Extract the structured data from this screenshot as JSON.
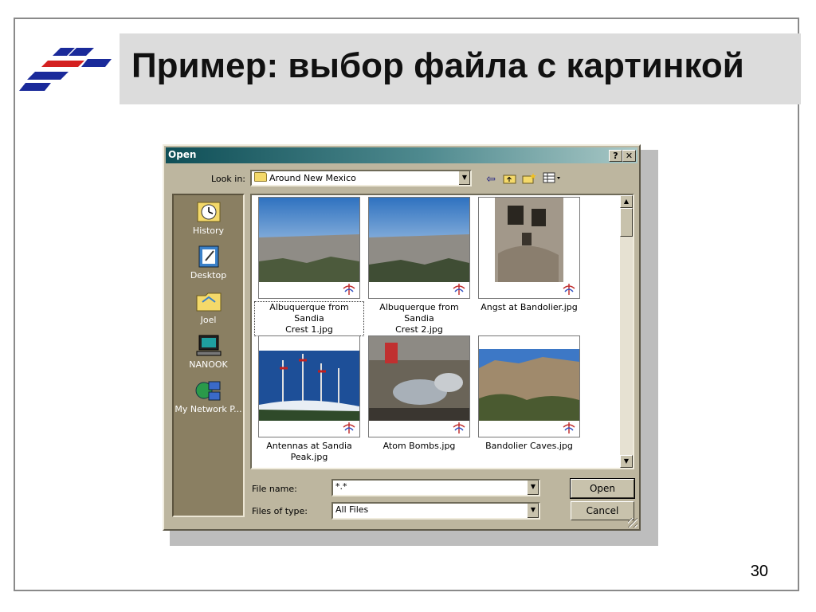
{
  "slide": {
    "title": "Пример: выбор файла с картинкой",
    "page_number": "30"
  },
  "dialog": {
    "title": "Open",
    "help_button": "?",
    "close_button": "✕",
    "look_in_label": "Look in:",
    "look_in_value": "Around New Mexico",
    "toolbar_icons": [
      "back-arrow-icon",
      "up-folder-icon",
      "new-folder-icon",
      "views-menu-icon"
    ],
    "places": [
      {
        "label": "History",
        "icon": "history-icon"
      },
      {
        "label": "Desktop",
        "icon": "desktop-icon"
      },
      {
        "label": "Joel",
        "icon": "user-folder-icon"
      },
      {
        "label": "NANOOK",
        "icon": "computer-icon"
      },
      {
        "label": "My Network P...",
        "icon": "network-places-icon"
      }
    ],
    "files": [
      {
        "name": "Albuquerque from Sandia Crest 1.jpg",
        "line1": "Albuquerque from Sandia",
        "line2": "Crest 1.jpg",
        "selected": true
      },
      {
        "name": "Albuquerque from Sandia Crest 2.jpg",
        "line1": "Albuquerque from Sandia",
        "line2": "Crest 2.jpg",
        "selected": false
      },
      {
        "name": "Angst at Bandolier.jpg",
        "line1": "Angst at Bandolier.jpg",
        "line2": "",
        "selected": false
      },
      {
        "name": "Antennas at Sandia Peak.jpg",
        "line1": "Antennas at Sandia",
        "line2": "Peak.jpg",
        "selected": false
      },
      {
        "name": "Atom Bombs.jpg",
        "line1": "Atom Bombs.jpg",
        "line2": "",
        "selected": false
      },
      {
        "name": "Bandolier Caves.jpg",
        "line1": "Bandolier Caves.jpg",
        "line2": "",
        "selected": false
      }
    ],
    "file_name_label": "File name:",
    "file_name_value": "*.*",
    "file_type_label": "Files of type:",
    "file_type_value": "All Files",
    "open_button": "Open",
    "cancel_button": "Cancel"
  },
  "colors": {
    "title_band": "#dcdcdc",
    "dialog_face": "#bdb69f",
    "places_bar": "#8a7f62",
    "titlebar_start": "#0f4f57"
  }
}
